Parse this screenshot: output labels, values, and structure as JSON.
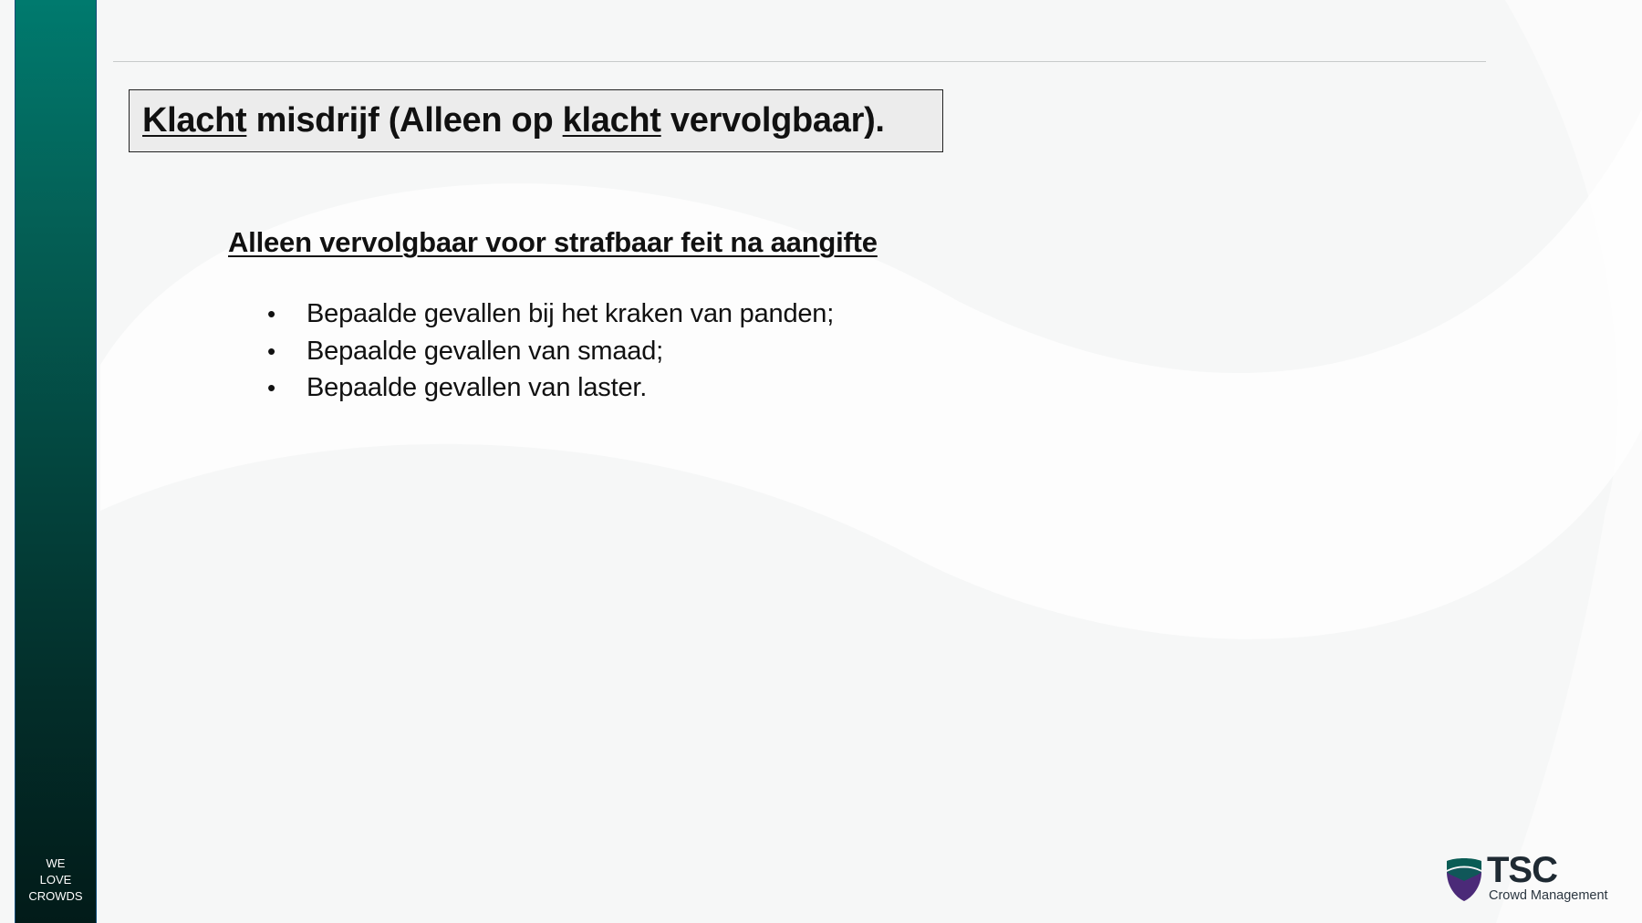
{
  "slide": {
    "title_parts": [
      "Klacht",
      " misdrijf (Alleen op ",
      "klacht",
      " vervolgbaar)."
    ],
    "subheading": "Alleen vervolgbaar voor strafbaar feit na aangifte",
    "bullets": [
      "Bepaalde gevallen bij het kraken van panden;",
      "Bepaalde gevallen van smaad;",
      "Bepaalde gevallen van laster."
    ],
    "bullet_glyph": "•"
  },
  "sidebar": {
    "tagline": [
      "WE",
      "LOVE",
      "CROWDS"
    ],
    "gradient_top": "#007a6e",
    "gradient_bottom": "#021b19"
  },
  "logo": {
    "name": "TSC",
    "subtitle": "Crowd Management",
    "icon": "shield-icon",
    "colors": {
      "teal": "#0a5c55",
      "purple": "#4b2a78"
    }
  },
  "colors": {
    "background": "#f6f7f7",
    "title_box_bg": "#ececec",
    "text": "#111111"
  }
}
